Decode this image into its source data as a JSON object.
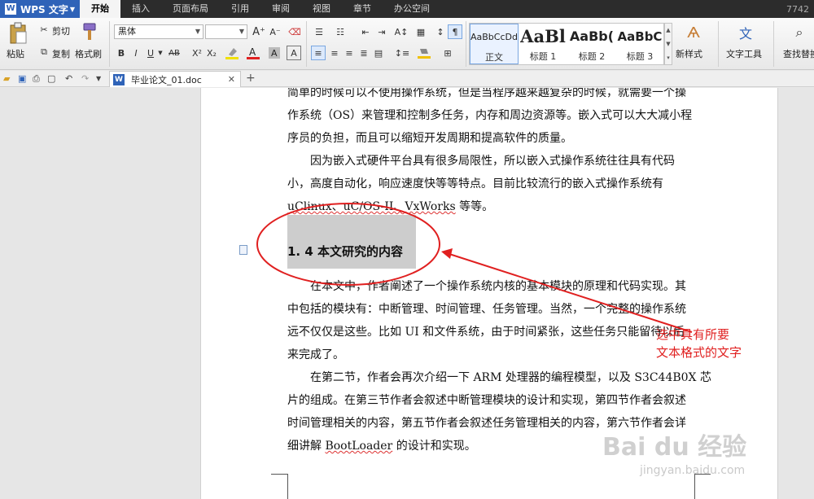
{
  "app": {
    "name": "WPS 文字",
    "logo": "W",
    "top_right": "7742"
  },
  "menu": {
    "tabs": [
      "开始",
      "插入",
      "页面布局",
      "引用",
      "审阅",
      "视图",
      "章节",
      "办公空间"
    ],
    "active": 0
  },
  "ribbon": {
    "paste": "粘贴",
    "cut": "剪切",
    "copy": "复制",
    "format_painter": "格式刷",
    "font_name": "黑体",
    "font_size": "",
    "bold": "B",
    "italic": "I",
    "underline": "U",
    "strike": "AB",
    "superscript": "X²",
    "subscript": "X₂",
    "styles": [
      {
        "preview": "AaBbCcDd",
        "name": "正文"
      },
      {
        "preview": "AaBl",
        "name": "标题 1"
      },
      {
        "preview": "AaBb(",
        "name": "标题 2"
      },
      {
        "preview": "AaBbC",
        "name": "标题 3"
      }
    ],
    "new_style": "新样式",
    "text_tools": "文字工具",
    "find_replace": "查找替换"
  },
  "tabbar": {
    "doc_name": "毕业论文_01.doc",
    "doc_icon": "W"
  },
  "document": {
    "para1": [
      "简单的时候可以不使用操作系统，但是当程序越来越复杂的时候，就需要一个操",
      "作系统（OS）来管理和控制多任务，内存和周边资源等。嵌入式可以大大减小程",
      "序员的负担，而且可以缩短开发周期和提高软件的质量。"
    ],
    "para2": [
      "因为嵌入式硬件平台具有很多局限性，所以嵌入式操作系统往往具有代码",
      "小，高度自动化，响应速度快等等特点。目前比较流行的嵌入式操作系统有"
    ],
    "para2_os": "uClinux、uC/OS-II、VxWorks",
    "para2_end": " 等等。",
    "heading": "1. 4  本文研究的内容",
    "para3": [
      "在本文中，作者阐述了一个操作系统内核的基本模块的原理和代码实现。其",
      "中包括的模块有：中断管理、时间管理、任务管理。当然，一个完整的操作系统",
      "远不仅仅是这些。比如 UI 和文件系统，由于时间紧张，这些任务只能留待以后",
      "来完成了。"
    ],
    "para4": [
      "在第二节，作者会再次介绍一下 ARM 处理器的编程模型，以及 S3C44B0X 芯",
      "片的组成。在第三节作者会叙述中断管理模块的设计和实现，第四节作者会叙述",
      "时间管理相关的内容，第五节作者会叙述任务管理相关的内容，第六节作者会详"
    ],
    "para4_last_a": "细讲解 ",
    "para4_last_b": "BootLoader",
    "para4_last_c": " 的设计和实现。"
  },
  "annotation": {
    "line1": "选中具有所要",
    "line2": "文本格式的文字",
    "color": "#e02020"
  },
  "watermark": {
    "main": "Bai du 经验",
    "sub": "jingyan.baidu.com"
  }
}
